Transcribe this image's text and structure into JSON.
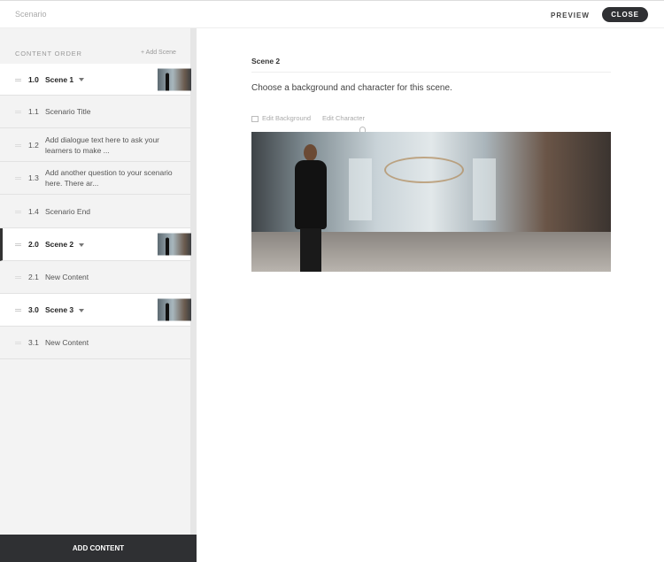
{
  "header": {
    "title": "Scenario",
    "preview": "PREVIEW",
    "close": "CLOSE"
  },
  "sidebar": {
    "content_order": "CONTENT ORDER",
    "add_scene": "+ Add Scene",
    "rows": [
      {
        "num": "1.0",
        "label": "Scene 1"
      },
      {
        "num": "1.1",
        "label": "Scenario Title"
      },
      {
        "num": "1.2",
        "label": "Add dialogue text here to ask your learners to make ..."
      },
      {
        "num": "1.3",
        "label": "Add another question to your scenario here. There ar..."
      },
      {
        "num": "1.4",
        "label": "Scenario End"
      },
      {
        "num": "2.0",
        "label": "Scene 2"
      },
      {
        "num": "2.1",
        "label": "New Content"
      },
      {
        "num": "3.0",
        "label": "Scene 3"
      },
      {
        "num": "3.1",
        "label": "New Content"
      }
    ],
    "footer": "ADD CONTENT"
  },
  "main": {
    "title": "Scene 2",
    "prompt": "Choose a background and character for this scene.",
    "edit_background": "Edit Background",
    "edit_character": "Edit Character"
  }
}
